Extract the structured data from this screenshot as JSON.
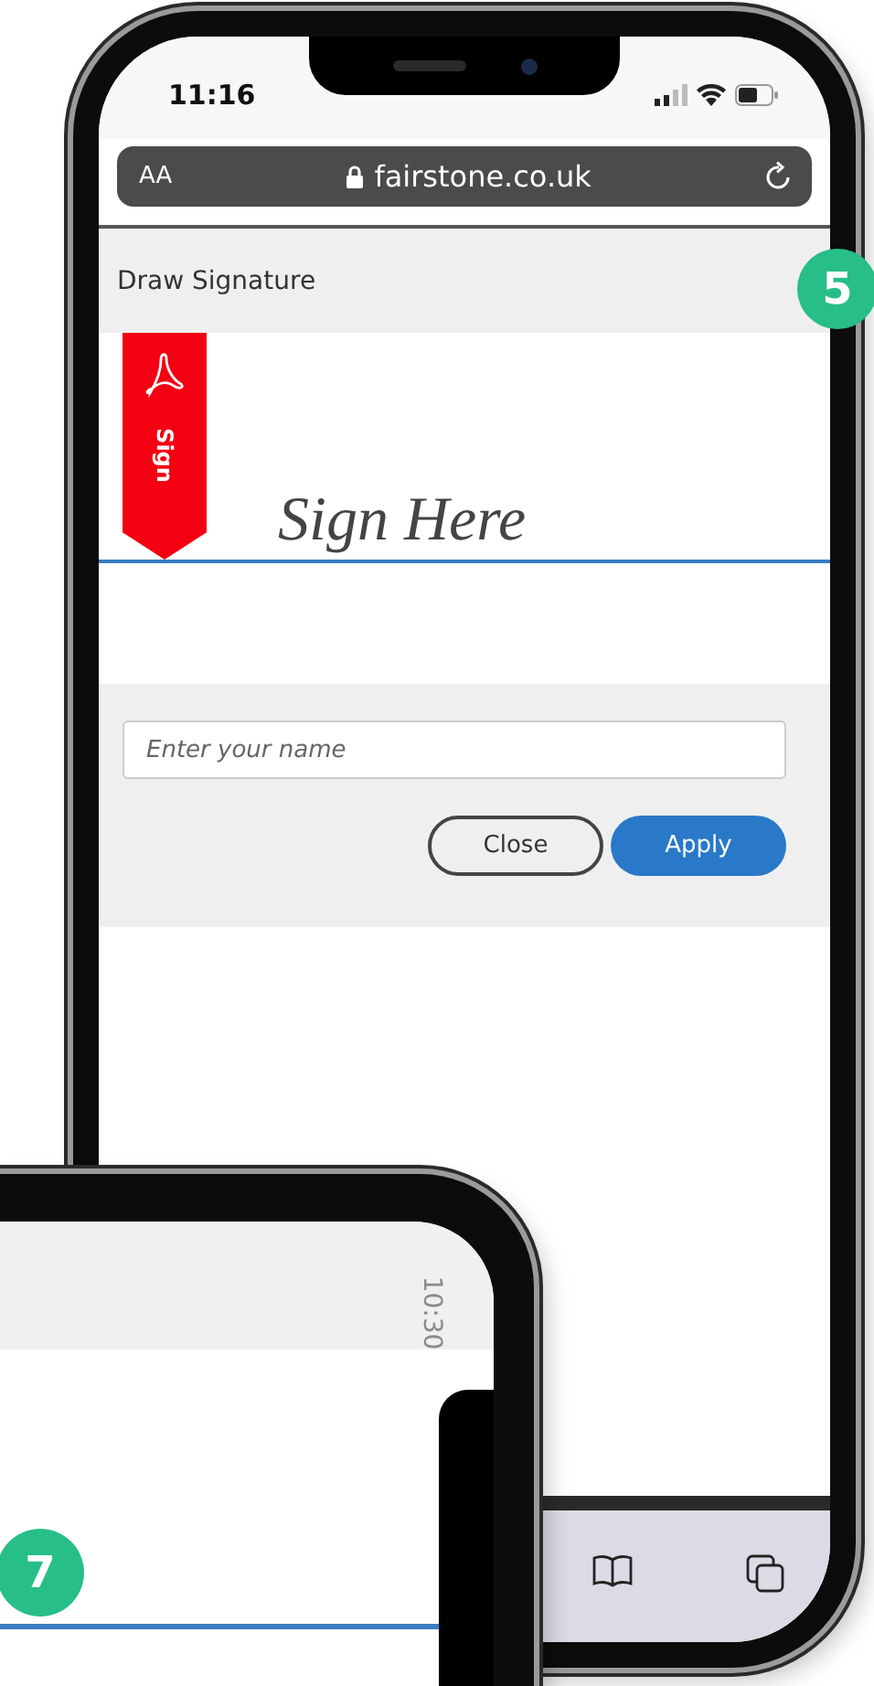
{
  "phone_main": {
    "status_bar": {
      "time": "11:16"
    },
    "address_bar": {
      "text_size": "AA",
      "url": "fairstone.co.uk"
    },
    "dialog": {
      "title": "Draw Signature",
      "ribbon": {
        "label": "Sign"
      },
      "signature_prompt": "Sign Here",
      "name_field": {
        "placeholder": "Enter your name"
      },
      "buttons": [
        {
          "label": "Close",
          "kind": "secondary"
        },
        {
          "label": "Apply",
          "kind": "primary"
        }
      ]
    }
  },
  "step_badges": [
    "5",
    "7"
  ],
  "phone_second": {
    "status_time": "10:30"
  }
}
